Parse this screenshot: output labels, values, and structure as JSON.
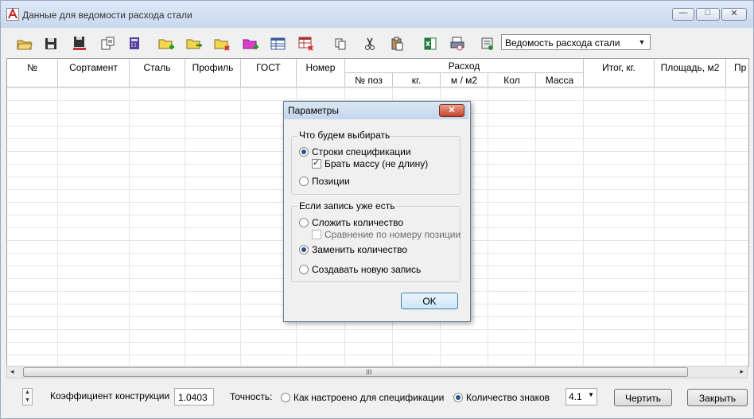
{
  "window": {
    "title": "Данные для ведомости расхода стали",
    "buttons": {
      "minimize": "—",
      "maximize": "□",
      "close": "✕"
    }
  },
  "toolbar": {
    "icons": [
      "open-icon",
      "save-icon",
      "save-as-icon",
      "export-icon",
      "calculator-icon",
      "folder-add-icon",
      "folder-edit-icon",
      "folder-delete-icon",
      "table-add-icon",
      "table-edit-icon",
      "table-delete-icon",
      "copy-icon",
      "cut-icon",
      "paste-icon",
      "excel-icon",
      "print-preview-icon",
      "settings-icon"
    ],
    "report_select": "Ведомость расхода стали"
  },
  "grid": {
    "columns": [
      "№",
      "Сортамент",
      "Сталь",
      "Профиль",
      "ГОСТ",
      "Номер"
    ],
    "group_header": "Расход",
    "group_columns": [
      "№ поз",
      "кг.",
      "м / м2",
      "Кол",
      "Масса"
    ],
    "columns_right": [
      "Итог, кг.",
      "Площадь, м2",
      "Пр"
    ]
  },
  "scrollbar": {
    "grip": "III",
    "left": "◂",
    "right": "▸"
  },
  "footer": {
    "coef_label": "Коэффициент конструкции",
    "coef_value": "1.0403",
    "precision_label": "Точность:",
    "option_spec": "Как настроено для спецификации",
    "option_digits": "Количество знаков",
    "digits_value": "4.1",
    "draw_button": "Чертить",
    "close_button": "Закрыть"
  },
  "dialog": {
    "title": "Параметры",
    "close": "✕",
    "group1": {
      "legend": "Что будем выбирать",
      "opt_rows": "Строки спецификации",
      "chk_mass": "Брать массу (не длину)",
      "opt_positions": "Позиции"
    },
    "group2": {
      "legend": "Если запись уже есть",
      "opt_sum": "Сложить количество",
      "chk_compare": "Сравнение по номеру позиции",
      "opt_replace": "Заменить количество",
      "opt_new": "Создавать новую запись"
    },
    "ok": "OK"
  },
  "colors": {
    "accent": "#2a4f8a",
    "title_bar": "#c8d8ee",
    "close_red": "#c5432a"
  }
}
